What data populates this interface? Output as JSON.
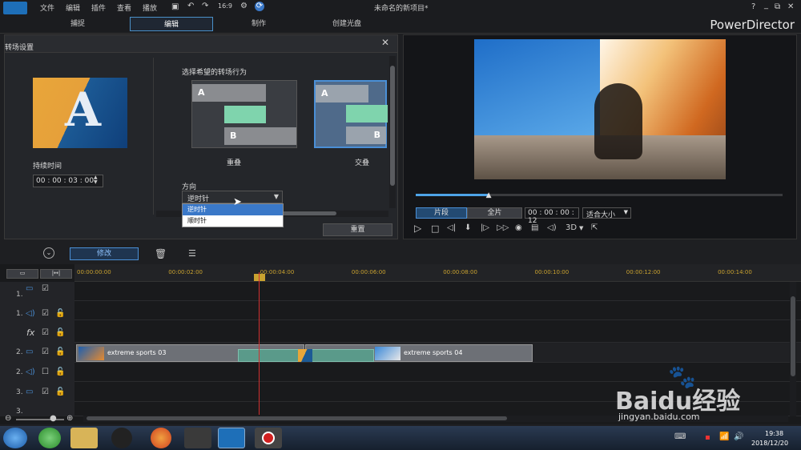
{
  "menu": [
    "文件",
    "编辑",
    "插件",
    "查看",
    "播放"
  ],
  "window_title": "未命名的新项目*",
  "window_controls": [
    "?",
    "_",
    "⧉",
    "✕"
  ],
  "tabs": [
    "捕捉",
    "编辑",
    "制作",
    "创建光盘"
  ],
  "brand": "PowerDirector",
  "transition_panel": {
    "title": "转场设置",
    "duration_label": "持续时间",
    "duration_value": "00 : 00 : 03 : 00",
    "behavior_label": "选择希望的转场行为",
    "option_overlap": "重叠",
    "option_cross": "交叠",
    "option_a": "A",
    "option_b": "B",
    "direction_label": "方向",
    "direction_selected": "逆时针",
    "direction_options": [
      "逆时针",
      "顺时针"
    ],
    "reset_button": "重置",
    "thumb_letter": "A"
  },
  "preview": {
    "mode_clip": "片段",
    "mode_full": "全片",
    "timecode": "00 : 00 : 00 : 12",
    "fit": "适合大小",
    "three_d": "3D",
    "progress": 0.2
  },
  "toolbar": {
    "modify": "修改"
  },
  "ruler": [
    "00:00:00:00",
    "00:00:02:00",
    "00:00:04:00",
    "00:00:06:00",
    "00:00:08:00",
    "00:00:10:00",
    "00:00:12:00",
    "00:00:14:00"
  ],
  "tracks": [
    {
      "num": "1.",
      "type": "video"
    },
    {
      "num": "1.",
      "type": "audio"
    },
    {
      "num": "fx",
      "type": "fx"
    },
    {
      "num": "2.",
      "type": "video"
    },
    {
      "num": "2.",
      "type": "audio"
    },
    {
      "num": "3.",
      "type": "video"
    },
    {
      "num": "3.",
      "type": "audio"
    }
  ],
  "clips": {
    "clip1": "extreme sports 03",
    "clip2": "extreme sports 04"
  },
  "taskbar": {
    "time": "19:38",
    "date": "2018/12/20"
  },
  "watermark": {
    "brand": "Baidu经验",
    "url": "jingyan.baidu.com"
  }
}
